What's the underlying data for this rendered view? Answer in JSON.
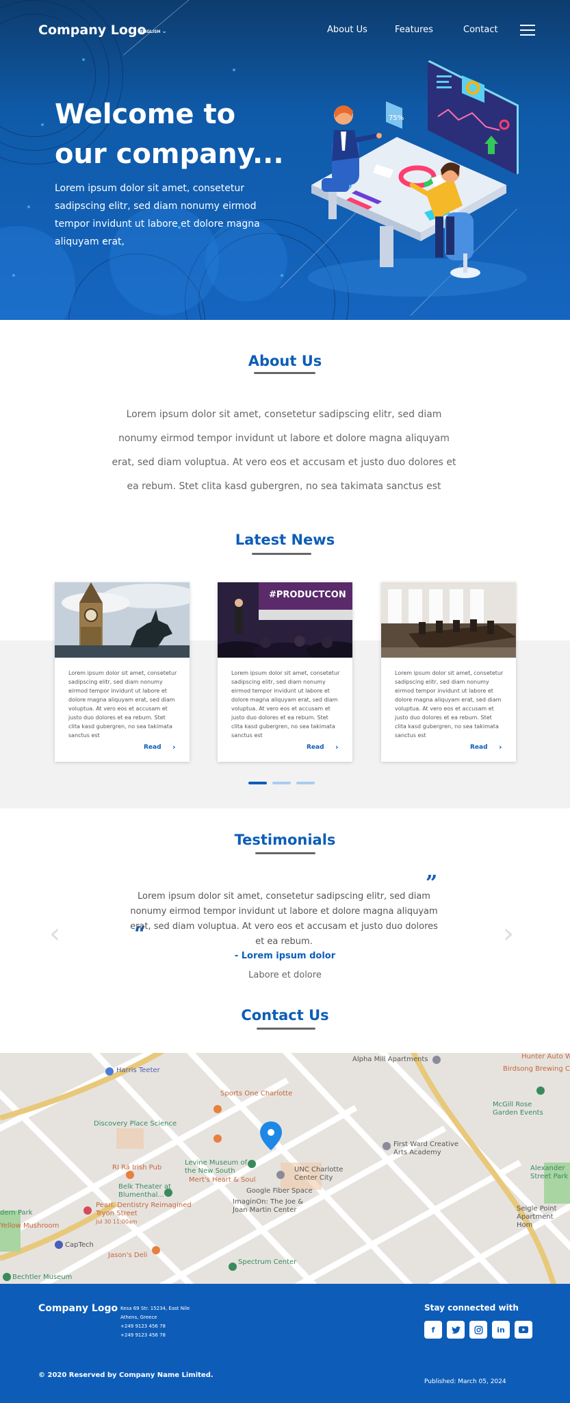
{
  "header": {
    "logo": "Company Logo",
    "language": "ENGLISH",
    "nav": [
      "About Us",
      "Features",
      "Contact"
    ]
  },
  "hero": {
    "title_line1": "Welcome to",
    "title_line2": "our company...",
    "text": "Lorem ipsum dolor sit amet, consetetur sadipscing elitr, sed diam nonumy eirmod tempor invidunt ut labore et dolore magna aliquyam erat,",
    "badge": "75%"
  },
  "about": {
    "title": "About Us",
    "text": "Lorem ipsum dolor sit amet, consetetur sadipscing elitr, sed diam nonumy eirmod tempor invidunt ut labore et dolore magna aliquyam erat, sed diam voluptua. At vero eos et accusam et justo duo dolores et ea rebum. Stet clita kasd gubergren, no sea takimata sanctus est"
  },
  "news": {
    "title": "Latest News",
    "cards": [
      {
        "text": "Lorem ipsum dolor sit amet, consetetur sadipscing elitr, sed diam nonumy eirmod tempor invidunt ut labore et dolore magna aliquyam erat, sed diam voluptua. At vero eos et accusam et justo duo dolores et ea rebum. Stet clita kasd gubergren, no sea takimata sanctus est",
        "read": "Read"
      },
      {
        "text": "Lorem ipsum dolor sit amet, consetetur sadipscing elitr, sed diam nonumy eirmod tempor invidunt ut labore et dolore magna aliquyam erat, sed diam voluptua. At vero eos et accusam et justo duo dolores et ea rebum. Stet clita kasd gubergren, no sea takimata sanctus est",
        "read": "Read",
        "image_text": "#PRODUCTCON"
      },
      {
        "text": "Lorem ipsum dolor sit amet, consetetur sadipscing elitr, sed diam nonumy eirmod tempor invidunt ut labore et dolore magna aliquyam erat, sed diam voluptua. At vero eos et accusam et justo duo dolores et ea rebum. Stet clita kasd gubergren, no sea takimata sanctus est",
        "read": "Read"
      }
    ]
  },
  "testimonials": {
    "title": "Testimonials",
    "text": "Lorem ipsum dolor sit amet, consetetur sadipscing elitr, sed diam nonumy eirmod tempor invidunt ut labore et dolore magna aliquyam erat, sed diam voluptua. At vero eos et accusam et justo duo dolores et ea rebum.",
    "name": "- Lorem ipsum dolor",
    "role": "Labore et dolore"
  },
  "contact": {
    "title": "Contact Us",
    "map_labels": [
      "Harris Teeter",
      "Sports One Charlotte",
      "Discovery Place Science",
      "RI Rá Irish Pub",
      "Levine Museum of the New South",
      "Mert's Heart & Soul",
      "Belk Theater at Blumenthal...",
      "Pearl. Dentistry Reimagined Tryon Street",
      "Jul 30 11:00am",
      "Yellow Mushroom",
      "CapTech",
      "Jason's Deli",
      "Bechtler Museum",
      "Google Fiber Space",
      "ImaginOn: The Joe & Joan Martin Center",
      "Spectrum Center",
      "UNC Charlotte Center City",
      "First Ward Creative Arts Academy",
      "Alpha Mill Apartments",
      "Hunter Auto Wrecker Serv",
      "Birdsong Brewing Co",
      "McGill Rose Garden Events",
      "Alexander Street Park",
      "Seigle Point Apartment Hom",
      "dern Park"
    ]
  },
  "footer": {
    "logo": "Company Logo",
    "address": [
      "Kesa 69 Str. 15234, East Nile",
      "Athens, Greece",
      "+249 9123 456 78",
      "+249 9123 456 78"
    ],
    "stay_connected": "Stay connected with",
    "social": [
      "f",
      "t",
      "ig",
      "in",
      "yt"
    ],
    "copyright": "© 2020 Reserved by Company Name Limited.",
    "published": "Published: March 05, 2024"
  },
  "colors": {
    "primary": "#0d5db8",
    "hero_dark": "#0d3c6e",
    "band": "#f2f2f2"
  },
  "carousel": {
    "active_index": 0,
    "count": 3
  }
}
